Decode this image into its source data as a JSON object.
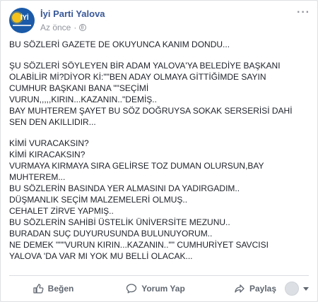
{
  "post": {
    "page_name": "İyi Parti Yalova",
    "timestamp": "Az önce",
    "separator": "·",
    "avatar_logo_text": "İYİ",
    "paragraphs": [
      "BU SÖZLERİ GAZETE DE OKUYUNCA KANIM DONDU...",
      "ŞU SÖZLERİ SÖYLEYEN BİR ADAM YALOVA'YA BELEDİYE BAŞKANI\nOLABİLİR Mİ?DİYOR Kİ:\"\"BEN ADAY OLMAYA GİTTİĞİMDE SAYIN\nCUMHUR BAŞKANI BANA \"\"SEÇİMİ\nVURUN,,,,,KIRIN...KAZANIN..\"DEMİŞ..\nBAY MUHTEREM ŞAYET BU SÖZ DOĞRUYSA SOKAK SERSERİSİ DAHİ\nSEN DEN AKILLIDIR...",
      "KİMİ VURACAKSIN?\nKİMİ KIRACAKSIN?\nVURMAYA KIRMAYA SIRA GELİRSE TOZ DUMAN OLURSUN,BAY\nMUHTEREM...\nBU SÖZLERİN BASINDA YER ALMASINI DA YADIRGADIM..\nDÜŞMANLIK SEÇİM MALZEMELERİ OLMUŞ..\nCEHALET ZİRVE YAPMIŞ..\nBU SÖZLERİN SAHİBİ ÜSTELİK ÜNİVERSİTE MEZUNU..\nBURADAN SUÇ DUYURUSUNDA BULUNUYORUM..\nNE DEMEK \"\"\"VURUN KIRIN...KAZANIN..\"\" CUMHURİYET SAVCISI\nYALOVA 'DA VAR MI YOK MU BELLİ OLACAK..."
    ]
  },
  "actions": {
    "like_label": "Beğen",
    "comment_label": "Yorum Yap",
    "share_label": "Paylaş"
  },
  "icons": {
    "more": "more-options-icon",
    "privacy": "globe-icon",
    "like": "thumbs-up-icon",
    "comment": "comment-bubble-icon",
    "share": "share-arrow-icon",
    "reaction_picker": "chevron-down-icon"
  },
  "colors": {
    "page_name": "#385898",
    "text": "#1d2129",
    "meta": "#90949c",
    "action": "#606770",
    "avatar_bg": "#1a5aa8",
    "avatar_sun": "#f4c21b"
  }
}
